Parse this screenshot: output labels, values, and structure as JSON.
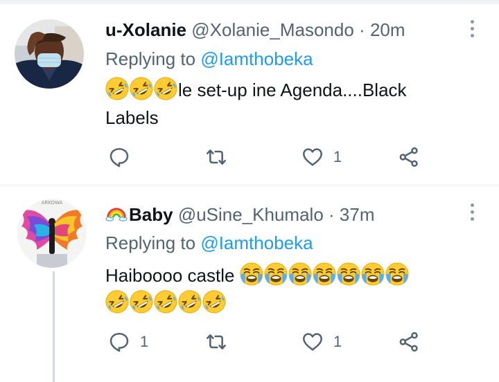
{
  "tweets": [
    {
      "display_name": "u-Xolanie",
      "handle": "@Xolanie_Masondo",
      "separator": "·",
      "time": "20m",
      "replying_label": "Replying to",
      "replying_to": "@Iamthobeka",
      "text_line1": "le set-up ine Agenda....Black",
      "text_line2": "Labels",
      "reply_count": "",
      "retweet_count": "",
      "like_count": "1"
    },
    {
      "display_name": "Baby",
      "handle": "@uSine_Khumalo",
      "separator": "·",
      "time": "37m",
      "replying_label": "Replying to",
      "replying_to": "@Iamthobeka",
      "text_line1": "Haiboooo castle",
      "reply_count": "1",
      "retweet_count": "",
      "like_count": "1"
    }
  ],
  "icons": {
    "reply": "reply-icon",
    "retweet": "retweet-icon",
    "like": "heart-icon",
    "share": "share-icon",
    "more": "more-options-icon",
    "rolling_laugh": "rolling-on-floor-laughing-emoji",
    "loud_cry": "loudly-crying-emoji",
    "rainbow": "rainbow-emoji"
  },
  "colors": {
    "link": "#1d9bf0",
    "secondary_text": "#536471",
    "icon": "#536471",
    "divider": "#e6ecf0"
  }
}
